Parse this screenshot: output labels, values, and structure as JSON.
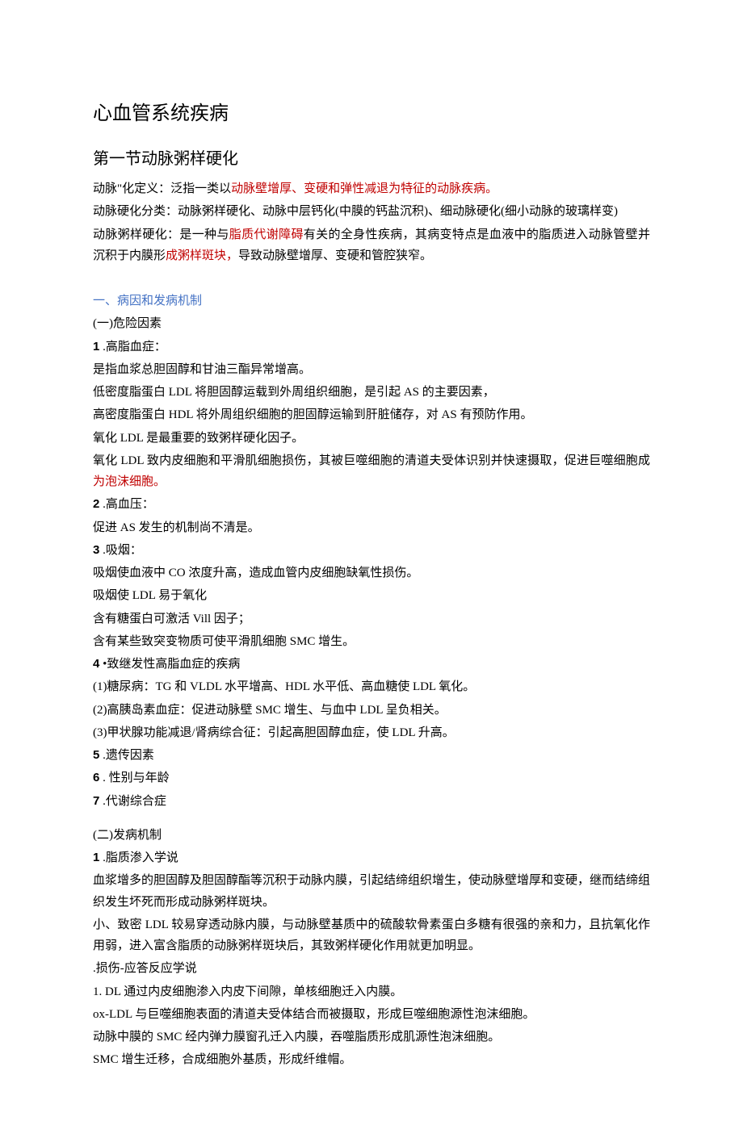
{
  "title_main": "心血管系统疾病",
  "title_section": "第一节动脉粥样硬化",
  "intro": {
    "def_prefix": "动脉\"化定义：泛指一类以",
    "def_red": "动脉壁增厚、变硬和弹性减退为特征的动脉疾病。",
    "class_text": "动脉硬化分类：动脉粥样硬化、动脉中层钙化(中膜的钙盐沉积)、细动脉硬化(细小动脉的玻璃样变)",
    "ath_prefix": "动脉粥样硬化：是一种与",
    "ath_red1": "脂质代谢障碍",
    "ath_mid": "有关的全身性疾病，其病变特点是血液中的脂质进入动脉管壁并沉积于内膜形",
    "ath_red2": "成粥样斑块，",
    "ath_suffix": "导致动脉壁增厚、变硬和管腔狭窄。"
  },
  "sec1_title": "一、病因和发病机制",
  "risk_title": "(一)危险因素",
  "risk1_num": "1",
  "risk1_label": " .高脂血症：",
  "risk1_p1": "是指血浆总胆固醇和甘油三酯异常增高。",
  "risk1_p2": "低密度脂蛋白 LDL 将胆固醇运载到外周组织细胞，是引起 AS 的主要因素，",
  "risk1_p3": "高密度脂蛋白 HDL 将外周组织细胞的胆固醇运输到肝脏储存，对 AS 有预防作用。",
  "risk1_p4": "氧化 LDL 是最重要的致粥样硬化因子。",
  "risk1_p5_prefix": "氧化 LDL 致内皮细胞和平滑肌细胞损伤，其被巨噬细胞的清道夫受体识别并快速摄取，促进巨噬细胞成",
  "risk1_p5_red": "为泡沫细胞。",
  "risk2_num": "2",
  "risk2_label": " .高血压：",
  "risk2_p1": "促进 AS 发生的机制尚不清是。",
  "risk3_num": "3",
  "risk3_label": " .吸烟：",
  "risk3_p1": "吸烟使血液中 CO 浓度升高，造成血管内皮细胞缺氧性损伤。",
  "risk3_p2": "吸烟使 LDL 易于氧化",
  "risk3_p3": "含有糖蛋白可激活 Vill 因子；",
  "risk3_p4": "含有某些致突变物质可使平滑肌细胞 SMC 增生。",
  "risk4_num": "4",
  "risk4_label": " •致继发性高脂血症的疾病",
  "risk4_p1": "(1)糖尿病：TG 和 VLDL 水平增高、HDL 水平低、高血糖使 LDL 氧化。",
  "risk4_p2": "(2)高胰岛素血症：促进动脉壁 SMC 增生、与血中 LDL 呈负相关。",
  "risk4_p3": "(3)甲状腺功能减退/肾病综合征：引起高胆固醇血症，使 LDL 升高。",
  "risk5_num": "5",
  "risk5_label": " .遗传因素",
  "risk6_num": "6",
  "risk6_label": " . 性别与年龄",
  "risk7_num": "7",
  "risk7_label": " .代谢综合症",
  "mech_title": "(二)发病机制",
  "mech1_num": "1",
  "mech1_label": " .脂质渗入学说",
  "mech1_p1": "血浆增多的胆固醇及胆固醇酯等沉积于动脉内膜，引起结缔组织增生，使动脉壁增厚和变硬，继而结缔组织发生坏死而形成动脉粥样斑块。",
  "mech1_p2": "小、致密 LDL 较易穿透动脉内膜，与动脉壁基质中的硫酸软骨素蛋白多糖有很强的亲和力，且抗氧化作用弱，进入富含脂质的动脉粥样斑块后，其致粥样硬化作用就更加明显。",
  "mech2_label": ".损伤-应答反应学说",
  "mech2_p1": "1. DL 通过内皮细胞渗入内皮下间隙，单核细胞迁入内膜。",
  "mech2_p2": "ox-LDL 与巨噬细胞表面的清道夫受体结合而被摄取，形成巨噬细胞源性泡沫细胞。",
  "mech2_p3": "动脉中膜的 SMC 经内弹力膜窗孔迁入内膜，吞噬脂质形成肌源性泡沫细胞。",
  "mech2_p4": "SMC 增生迁移，合成细胞外基质，形成纤维帽。"
}
